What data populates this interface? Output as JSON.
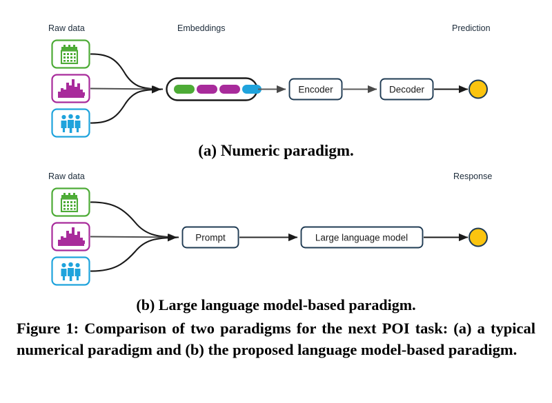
{
  "figure": {
    "panel_a": {
      "caption": "(a) Numeric paradigm.",
      "column_labels": {
        "input": "Raw data",
        "middle": "Embeddings",
        "output": "Prediction"
      },
      "input_cards": [
        {
          "name": "calendar-card",
          "icon": "calendar-icon",
          "color": "#4DAB36"
        },
        {
          "name": "histogram-card",
          "icon": "histogram-icon",
          "color": "#A82B9B"
        },
        {
          "name": "people-card",
          "icon": "people-group-icon",
          "color": "#1FA3DC"
        }
      ],
      "embedding_pills": [
        {
          "color": "#4DAB36"
        },
        {
          "color": "#A82B9B"
        },
        {
          "color": "#A82B9B"
        },
        {
          "color": "#1FA3DC"
        }
      ],
      "process_nodes": [
        {
          "name": "encoder-node",
          "label": "Encoder"
        },
        {
          "name": "decoder-node",
          "label": "Decoder"
        }
      ],
      "output_node": {
        "name": "prediction-node",
        "label": "",
        "color": "#FBC40F"
      }
    },
    "panel_b": {
      "caption": "(b) Large language model-based paradigm.",
      "column_labels": {
        "input": "Raw data",
        "output": "Response"
      },
      "input_cards": [
        {
          "name": "calendar-card",
          "icon": "calendar-icon",
          "color": "#4DAB36"
        },
        {
          "name": "histogram-card",
          "icon": "histogram-icon",
          "color": "#A82B9B"
        },
        {
          "name": "people-card",
          "icon": "people-group-icon",
          "color": "#1FA3DC"
        }
      ],
      "process_nodes": [
        {
          "name": "prompt-node",
          "label": "Prompt"
        },
        {
          "name": "llm-node",
          "label": "Large language model"
        }
      ],
      "output_node": {
        "name": "response-node",
        "label": "",
        "color": "#FBC40F"
      }
    },
    "figure_caption": "Figure 1: Comparison of two paradigms for the next POI task: (a) a typical numerical paradigm and (b) the proposed language model-based paradigm.",
    "colors": {
      "green": "#4DAB36",
      "purple": "#A82B9B",
      "blue": "#1FA3DC",
      "yellow": "#FBC40F",
      "node_border": "#1F3B53",
      "arrow_dark": "#1a1a1a",
      "arrow_grey": "#5a5a5a"
    }
  }
}
